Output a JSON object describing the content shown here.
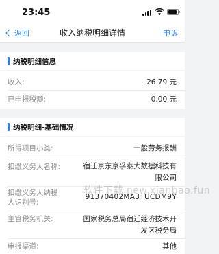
{
  "status_bar": {
    "time": "23:45"
  },
  "nav": {
    "back_label": "返回",
    "title": "收入纳税明细详情",
    "appeal_label": "申诉"
  },
  "section1": {
    "title": "纳税明细信息",
    "rows": [
      {
        "label": "收入:",
        "value": "26.79 元"
      },
      {
        "label": "已申报税额:",
        "value": "0.00 元"
      }
    ]
  },
  "section2": {
    "title": "纳税明细-基础情况",
    "rows": [
      {
        "label": "所得项目小类:",
        "value": "一般劳务报酬"
      },
      {
        "label": "扣缴义务人名称:",
        "value_line1": "宿迁京东京孚泰大数据科技有",
        "value_line2": "限公司"
      },
      {
        "label_line1": "扣缴义务人纳税",
        "label_line2": "人识别号:",
        "value": "91370402MA3TUCDM9Y"
      },
      {
        "label": "主管税务机关:",
        "value_line1": "国家税务总局宿迁经济技术开",
        "value_line2": "发区税务局"
      },
      {
        "label": "申报渠道:",
        "value": "其他"
      }
    ]
  },
  "watermark": "软件下载 new.xianbao.fun"
}
